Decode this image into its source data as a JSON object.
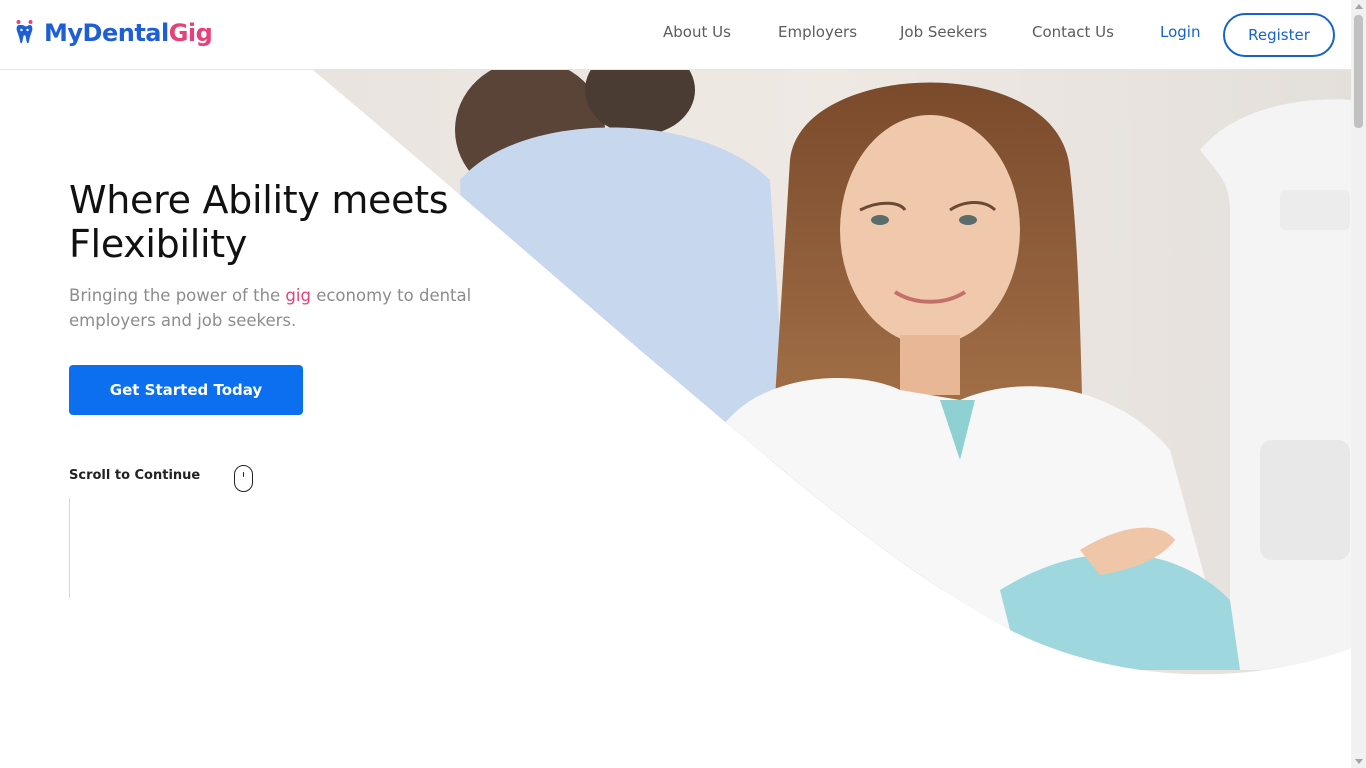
{
  "brand": {
    "name_part1": "MyDental",
    "name_part2": "Gig"
  },
  "nav": {
    "items": [
      {
        "label": "About Us"
      },
      {
        "label": "Employers"
      },
      {
        "label": "Job Seekers"
      },
      {
        "label": "Contact Us"
      }
    ],
    "login": "Login",
    "register": "Register"
  },
  "hero": {
    "title": "Where Ability meets Flexibility",
    "subtitle_before": "Bringing the power of the ",
    "subtitle_highlight": "gig",
    "subtitle_after": " economy to dental employers and job seekers.",
    "cta": "Get Started Today",
    "scroll_hint": "Scroll to Continue"
  },
  "colors": {
    "brand_blue": "#1f5fd6",
    "brand_pink": "#e5427b",
    "cta_blue": "#0b6ff0",
    "link_blue": "#1763c9"
  }
}
